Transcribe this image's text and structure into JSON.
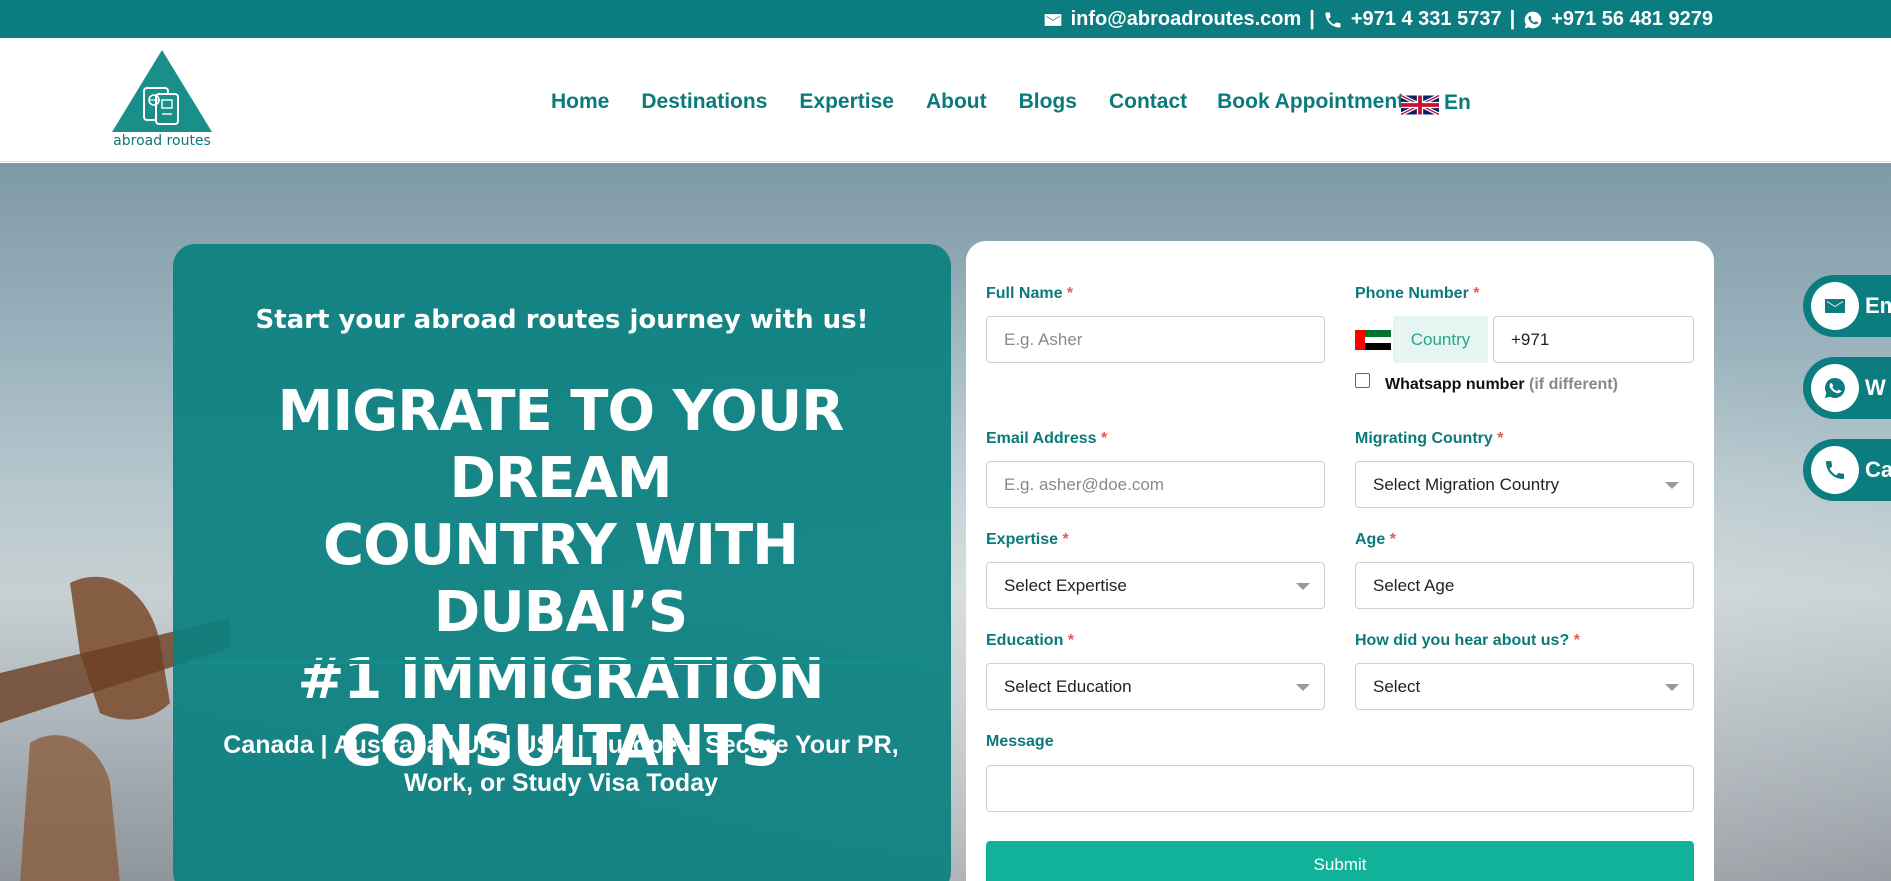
{
  "topbar": {
    "email": "info@abroadroutes.com",
    "sep1": "|",
    "phone": "+971 4 331 5737",
    "sep2": "|",
    "whatsapp": "+971 56 481 9279"
  },
  "logo": {
    "text": "abroad routes"
  },
  "nav": {
    "items": [
      "Home",
      "Destinations",
      "Expertise",
      "About",
      "Blogs",
      "Contact",
      "Book Appointment"
    ],
    "language": "En"
  },
  "hero": {
    "subheading": "Start your abroad routes journey with us!",
    "heading": [
      "MIGRATE TO YOUR DREAM",
      "COUNTRY WITH DUBAI’S",
      "#1 IMMIGRATION",
      "CONSULTANTS"
    ],
    "tagline": [
      "Canada | Australia | UK | USA | Europe – Secure Your PR,",
      "Work, or Study Visa Today"
    ]
  },
  "form": {
    "full_name_label": "Full Name",
    "full_name_placeholder": "E.g. Asher",
    "phone_label": "Phone Number",
    "country_button": "Country",
    "phone_value": "+971",
    "whatsapp_label": "Whatsapp number",
    "whatsapp_hint": "(if different)",
    "email_label": "Email Address",
    "email_placeholder": "E.g. asher@doe.com",
    "migrating_label": "Migrating Country",
    "migrating_value": "Select Migration Country",
    "expertise_label": "Expertise",
    "expertise_value": "Select Expertise",
    "age_label": "Age",
    "age_value": "Select Age",
    "education_label": "Education",
    "education_value": "Select Education",
    "hear_label": "How did you hear about us?",
    "hear_value": "Select",
    "message_label": "Message",
    "required_mark": "*",
    "submit": "Submit"
  },
  "floating": {
    "email_label": "Em",
    "whatsapp_label": "W",
    "call_label": "Ca"
  },
  "colors": {
    "brand_teal": "#0b7c80",
    "submit_green": "#12b29a",
    "required_red": "#e15a5a"
  },
  "icons": [
    "email-icon",
    "phone-icon",
    "whatsapp-icon",
    "uk-flag-icon",
    "uae-flag-icon",
    "dropdown-caret-icon"
  ]
}
